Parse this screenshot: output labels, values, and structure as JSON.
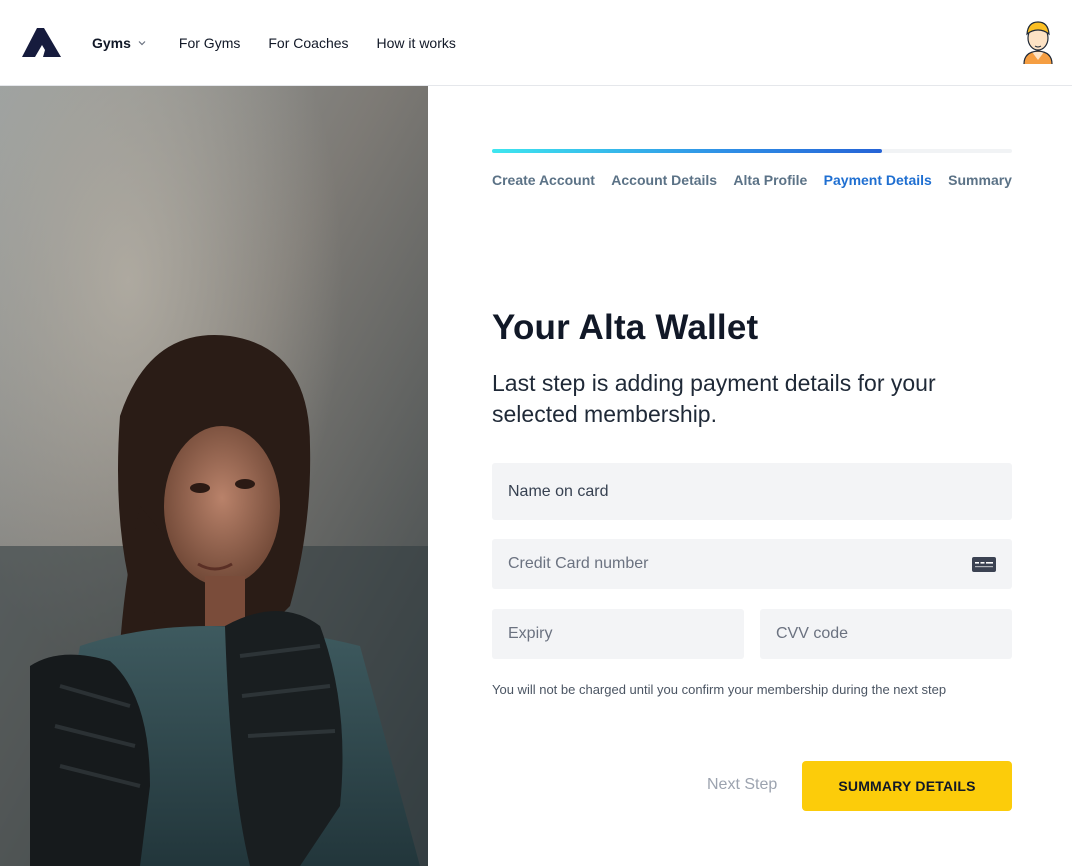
{
  "header": {
    "nav": {
      "gyms": "Gyms",
      "for_gyms": "For Gyms",
      "for_coaches": "For Coaches",
      "how_it_works": "How it works"
    }
  },
  "progress": {
    "completed_fraction": 0.75
  },
  "steps": [
    {
      "label": "Create Account",
      "active": false
    },
    {
      "label": "Account Details",
      "active": false
    },
    {
      "label": "Alta Profile",
      "active": false
    },
    {
      "label": "Payment Details",
      "active": true
    },
    {
      "label": "Summary",
      "active": false
    }
  ],
  "wallet": {
    "title": "Your Alta Wallet",
    "subtitle": "Last step is adding payment details for your selected membership.",
    "fields": {
      "name_placeholder": "Name on card",
      "card_placeholder": "Credit Card number",
      "expiry_placeholder": "Expiry",
      "cvv_placeholder": "CVV code"
    },
    "note": "You will not be charged until you confirm your membership during the next step",
    "next_step_label": "Next Step",
    "cta_label": "SUMMARY DETAILS"
  },
  "icons": {
    "logo": "alta-logo-icon",
    "avatar": "user-avatar-icon",
    "chevron": "chevron-down-icon",
    "card": "credit-card-icon"
  },
  "colors": {
    "accent_yellow": "#fccc0a",
    "active_step": "#1f6fd1",
    "inactive_step": "#5b7286",
    "progress_start": "#3ee6ef",
    "progress_end": "#2563d6"
  }
}
